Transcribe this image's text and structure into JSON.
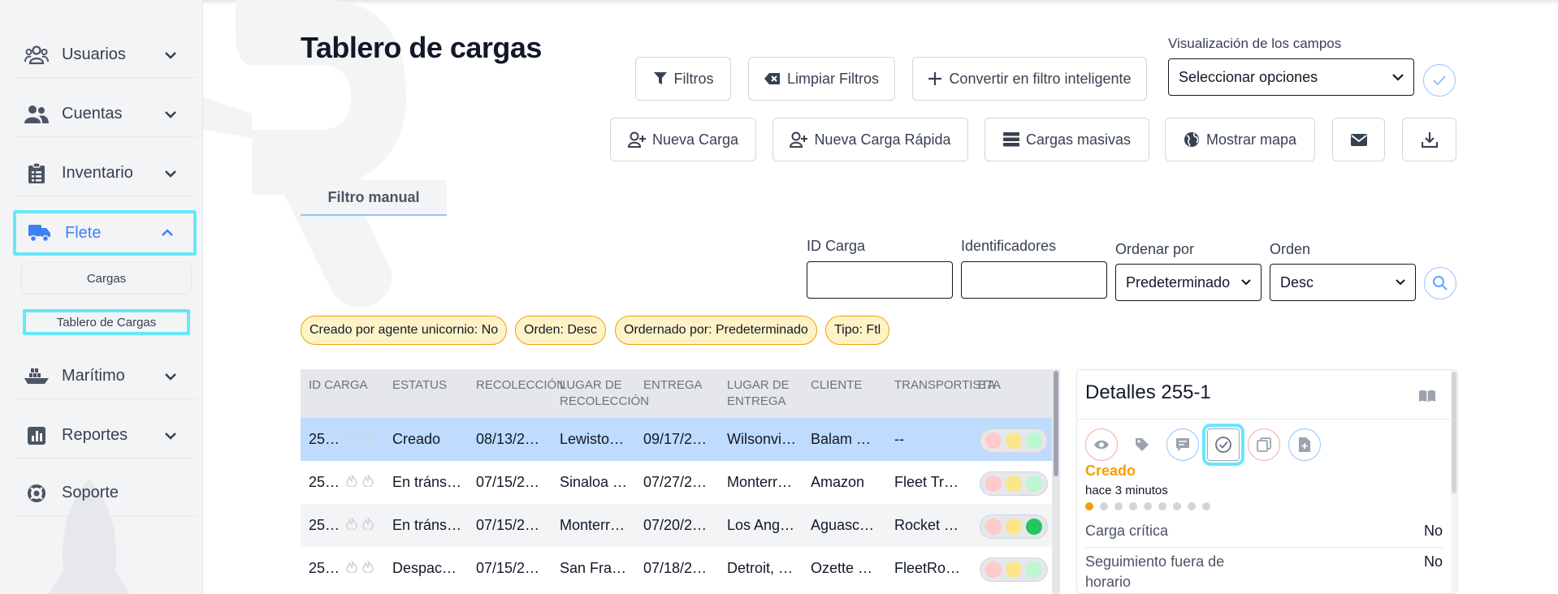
{
  "sidebar": {
    "items": [
      {
        "label": "Usuarios",
        "icon": "users-icon"
      },
      {
        "label": "Cuentas",
        "icon": "user-group-icon"
      },
      {
        "label": "Inventario",
        "icon": "clipboard-icon"
      },
      {
        "label": "Flete",
        "icon": "truck-icon"
      },
      {
        "label": "Marítimo",
        "icon": "ship-icon"
      },
      {
        "label": "Reportes",
        "icon": "chart-icon"
      },
      {
        "label": "Soporte",
        "icon": "support-icon"
      }
    ],
    "subitems": [
      "Cargas",
      "Tablero de Cargas"
    ]
  },
  "header": {
    "title": "Tablero de cargas",
    "filters_label": "Filtros",
    "clear_filters_label": "Limpiar Filtros",
    "smart_filter_label": "Convertir en filtro inteligente",
    "fields_visibility_label": "Visualización de los campos",
    "fields_select_value": "Seleccionar opciones",
    "new_load_label": "Nueva Carga",
    "new_quick_load_label": "Nueva Carga Rápida",
    "bulk_loads_label": "Cargas masivas",
    "show_map_label": "Mostrar mapa"
  },
  "tabs": [
    {
      "label": "Filtro manual"
    }
  ],
  "search": {
    "id_label": "ID Carga",
    "identifiers_label": "Identificadores",
    "order_by_label": "Ordenar por",
    "order_by_value": "Predeterminado",
    "order_label": "Orden",
    "order_value": "Desc"
  },
  "chips": [
    "Creado por agente unicornio: No",
    "Orden: Desc",
    "Ordernado por: Predeterminado",
    "Tipo: Ftl"
  ],
  "table": {
    "headers": [
      "ID CARGA",
      "ESTATUS",
      "RECOLECCIÓN",
      "LUGAR DE RECOLECCIÓN",
      "ENTREGA",
      "LUGAR DE ENTREGA",
      "CLIENTE",
      "TRANSPORTISTA",
      "ETA"
    ],
    "rows": [
      {
        "id": "25…",
        "status": "Creado",
        "pickup": "08/13/2…",
        "pickup_place": "Lewisto…",
        "delivery": "09/17/2…",
        "delivery_place": "Wilsonvi…",
        "client": "Balam …",
        "carrier": "--",
        "lights": [
          "#fecaca",
          "#fde68a",
          "#bbf7d0"
        ]
      },
      {
        "id": "25…",
        "status": "En tráns…",
        "pickup": "07/15/2…",
        "pickup_place": "Sinaloa …",
        "delivery": "07/27/2…",
        "delivery_place": "Monterr…",
        "client": "Amazon",
        "carrier": "Fleet Tr…",
        "lights": [
          "#fecaca",
          "#fde68a",
          "#bbf7d0"
        ]
      },
      {
        "id": "25…",
        "status": "En tráns…",
        "pickup": "07/15/2…",
        "pickup_place": "Monterr…",
        "delivery": "07/20/2…",
        "delivery_place": "Los Ang…",
        "client": "Aguasc…",
        "carrier": "Rocket …",
        "lights": [
          "#fecaca",
          "#fde68a",
          "#22c55e"
        ]
      },
      {
        "id": "25…",
        "status": "Despac…",
        "pickup": "07/15/2…",
        "pickup_place": "San Fra…",
        "delivery": "07/18/2…",
        "delivery_place": "Detroit, …",
        "client": "Ozette …",
        "carrier": "FleetRo…",
        "lights": [
          "#fecaca",
          "#fde68a",
          "#bbf7d0"
        ]
      }
    ]
  },
  "detail": {
    "title": "Detalles 255-1",
    "status": "Creado",
    "ago": "hace 3 minutos",
    "progress_steps": 9,
    "progress_current": 1,
    "fields": [
      {
        "label": "Carga crítica",
        "value": "No"
      },
      {
        "label": "Seguimiento fuera de horario",
        "value": "No"
      }
    ]
  },
  "colors": {
    "accent": "#3b82f6",
    "highlight": "#67e8f9",
    "chip_bg": "#fef3c7",
    "chip_border": "#f59e0b",
    "selected_row": "#bfdbfe"
  }
}
